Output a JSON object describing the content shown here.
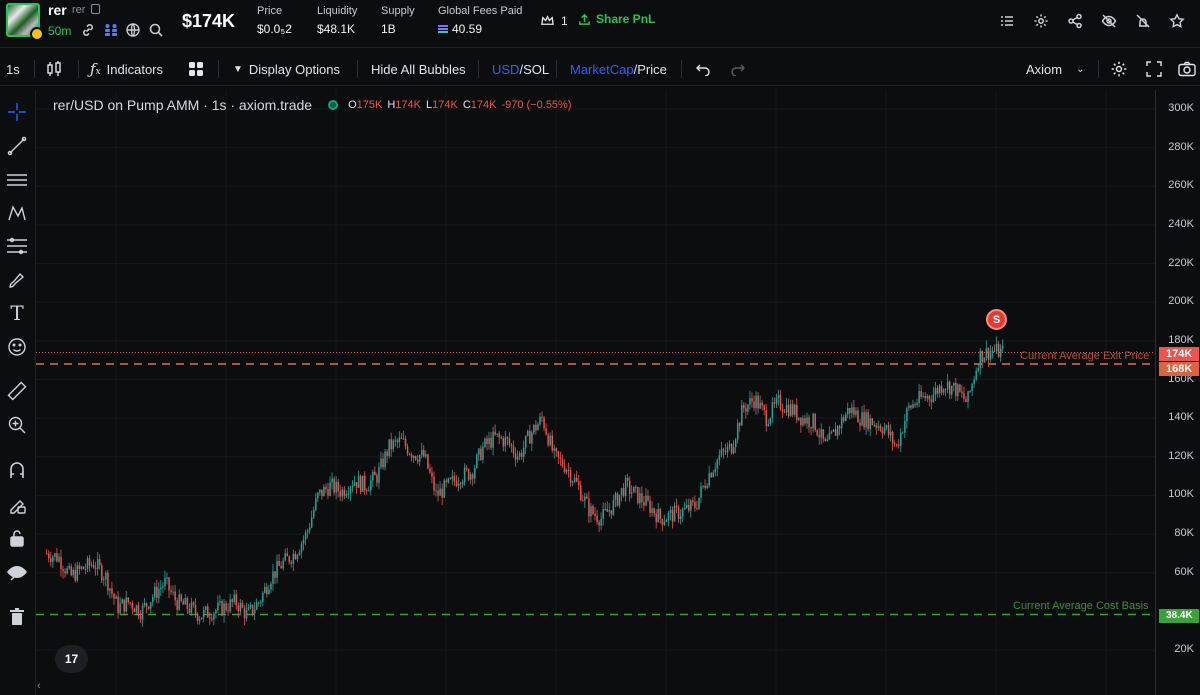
{
  "header": {
    "token_symbol": "rer",
    "token_name": "rer",
    "age": "50m",
    "market_cap": "$174K",
    "stats": [
      {
        "label": "Price",
        "value": "$0.0₅2"
      },
      {
        "label": "Liquidity",
        "value": "$48.1K"
      },
      {
        "label": "Supply",
        "value": "1B"
      },
      {
        "label": "Global Fees Paid",
        "value": "40.59"
      }
    ],
    "watchlist_count": "1",
    "share_pnl_label": "Share PnL"
  },
  "toolbar": {
    "interval": "1s",
    "indicators_label": "Indicators",
    "display_options_label": "Display Options",
    "hide_bubbles_label": "Hide All Bubbles",
    "currency_toggle": {
      "active": "USD",
      "sep": "/",
      "inactive": "SOL"
    },
    "metric_toggle": {
      "active": "MarketCap",
      "sep": "/",
      "inactive": "Price"
    },
    "theme_select": "Axiom"
  },
  "legend": {
    "title": "rer/USD on Pump AMM · 1s · axiom.trade",
    "open_label": "O",
    "open": "175K",
    "high_label": "H",
    "high": "174K",
    "low_label": "L",
    "low": "174K",
    "close_label": "C",
    "close": "174K",
    "change": "-970 (−0.55%)"
  },
  "price_axis": {
    "ticks": [
      "300K",
      "280K",
      "260K",
      "240K",
      "220K",
      "200K",
      "180K",
      "160K",
      "140K",
      "120K",
      "100K",
      "80K",
      "60K",
      "20K"
    ],
    "tags": {
      "current": "174K",
      "exit": "168K",
      "cost": "38.4K"
    }
  },
  "lines": {
    "exit_label": "Current Average Exit Price",
    "cost_label": "Current Average Cost Basis"
  },
  "markers": {
    "sell": "S"
  },
  "tv_logo": "17",
  "colors": {
    "up": "#26a69a",
    "down": "#ef5350",
    "accent": "#2962ff",
    "green": "#22c55e",
    "exit_line": "#e2704c",
    "cost_line": "#3aa23a"
  },
  "chart_data": {
    "type": "candlestick",
    "title": "rer/USD on Pump AMM · 1s · axiom.trade",
    "y_unit": "USD market cap",
    "ylim": [
      10000,
      310000
    ],
    "grid": true,
    "current_price": 174000,
    "horizontal_lines": [
      {
        "name": "Current Average Exit Price",
        "value": 168000
      },
      {
        "name": "Current Average Cost Basis",
        "value": 38400
      }
    ],
    "price_path": [
      70000,
      68000,
      58000,
      62000,
      65000,
      58000,
      42000,
      45000,
      40000,
      48000,
      55000,
      45000,
      42000,
      38000,
      40000,
      42000,
      45000,
      38000,
      45000,
      58000,
      65000,
      70000,
      80000,
      100000,
      105000,
      102000,
      108000,
      105000,
      110000,
      125000,
      128000,
      122000,
      120000,
      100000,
      105000,
      110000,
      112000,
      125000,
      130000,
      128000,
      120000,
      132000,
      140000,
      120000,
      115000,
      105000,
      92000,
      88000,
      95000,
      105000,
      100000,
      95000,
      88000,
      90000,
      92000,
      95000,
      110000,
      120000,
      125000,
      145000,
      150000,
      140000,
      148000,
      145000,
      140000,
      138000,
      125000,
      135000,
      145000,
      140000,
      138000,
      135000,
      125000,
      145000,
      150000,
      152000,
      158000,
      155000,
      148000,
      172000,
      175000,
      174000
    ]
  }
}
